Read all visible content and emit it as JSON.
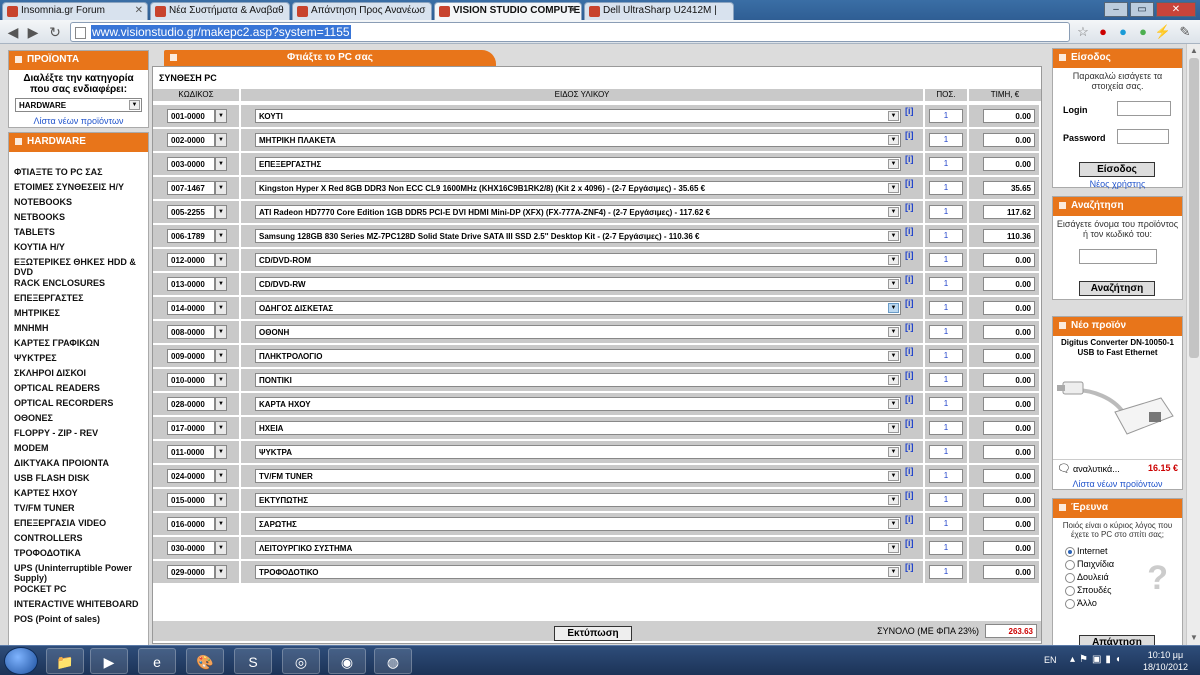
{
  "browser": {
    "tabs": [
      {
        "title": "Insomnia.gr Forum"
      },
      {
        "title": "Νέα Συστήματα & Αναβαθ"
      },
      {
        "title": "Απάντηση Προς Ανανέωσ"
      },
      {
        "title": "VISION STUDIO COMPUTE"
      },
      {
        "title": "Dell UltraSharp U2412M |"
      }
    ],
    "url": "www.visionstudio.gr/makepc2.asp?system=1155"
  },
  "left": {
    "products_title": "ΠΡΟΪΟΝΤΑ",
    "category_prompt": "Διαλέξτε την κατηγορία που σας ενδιαφέρει:",
    "category_value": "HARDWARE",
    "new_products_link": "Λίστα νέων προϊόντων",
    "hardware_title": "HARDWARE",
    "menu": [
      "ΦΤΙΑΞΤΕ ΤΟ PC ΣΑΣ",
      "ΕΤΟΙΜΕΣ ΣΥΝΘΕΣΕΙΣ Η/Υ",
      "NOTEBOOKS",
      "NETBOOKS",
      "TABLETS",
      "ΚΟΥΤΙΑ Η/Υ",
      "ΕΞΩΤΕΡΙΚΕΣ ΘΗΚΕΣ HDD & DVD",
      "RACK ENCLOSURES",
      "ΕΠΕΞΕΡΓΑΣΤΕΣ",
      "ΜΗΤΡΙΚΕΣ",
      "ΜΝΗΜΗ",
      "ΚΑΡΤΕΣ ΓΡΑΦΙΚΩΝ",
      "ΨΥΚΤΡΕΣ",
      "ΣΚΛΗΡΟΙ ΔΙΣΚΟΙ",
      "OPTICAL READERS",
      "OPTICAL RECORDERS",
      "ΟΘΟΝΕΣ",
      "FLOPPY - ZIP - REV",
      "MODEM",
      "ΔΙΚΤΥΑΚΑ ΠΡΟΙΟΝΤΑ",
      "USB FLASH DISK",
      "ΚΑΡΤΕΣ ΗΧΟΥ",
      "TV/FM TUNER",
      "ΕΠΕΞΕΡΓΑΣΙΑ VIDEO",
      "CONTROLLERS",
      "ΤΡΟΦΟΔΟΤΙΚΑ",
      "UPS (Uninterruptible Power Supply)",
      "POCKET PC",
      "INTERACTIVE WHITEBOARD",
      "POS (Point of sales)"
    ]
  },
  "main": {
    "tab_label": "Φτιάξτε το PC σας",
    "section_title": "ΣΥΝΘΕΣΗ PC",
    "headers": {
      "code": "ΚΩΔΙΚΟΣ",
      "desc": "ΕΙΔΟΣ ΥΛΙΚΟΥ",
      "qty": "ΠΟΣ.",
      "price": "ΤΙΜΗ, €"
    },
    "info_label": "[i]",
    "rows": [
      {
        "code": "001-0000",
        "desc": "ΚΟΥΤΙ",
        "qty": "1",
        "price": "0.00"
      },
      {
        "code": "002-0000",
        "desc": "ΜΗΤΡΙΚΗ ΠΛΑΚΕΤΑ",
        "qty": "1",
        "price": "0.00"
      },
      {
        "code": "003-0000",
        "desc": "ΕΠΕΞΕΡΓΑΣΤΗΣ",
        "qty": "1",
        "price": "0.00"
      },
      {
        "code": "007-1467",
        "desc": "Kingston Hyper X Red 8GB DDR3 Non ECC CL9 1600MHz (KHX16C9B1RK2/8) (Kit 2 x 4096) - (2-7 Εργάσιμες) - 35.65 €",
        "qty": "1",
        "price": "35.65"
      },
      {
        "code": "005-2255",
        "desc": "ATI Radeon HD7770 Core Edition 1GB DDR5 PCI-E DVI HDMI Mini-DP (XFX) (FX-777A-ZNF4) - (2-7 Εργάσιμες) - 117.62 €",
        "qty": "1",
        "price": "117.62"
      },
      {
        "code": "006-1789",
        "desc": "Samsung 128GB 830 Series MZ-7PC128D Solid State Drive SATA III SSD 2.5'' Desktop Kit - (2-7 Εργάσιμες) - 110.36 €",
        "qty": "1",
        "price": "110.36"
      },
      {
        "code": "012-0000",
        "desc": "CD/DVD-ROM",
        "qty": "1",
        "price": "0.00"
      },
      {
        "code": "013-0000",
        "desc": "CD/DVD-RW",
        "qty": "1",
        "price": "0.00"
      },
      {
        "code": "014-0000",
        "desc": "ΟΔΗΓΟΣ ΔΙΣΚΕΤΑΣ",
        "qty": "1",
        "price": "0.00"
      },
      {
        "code": "008-0000",
        "desc": "ΟΘΟΝΗ",
        "qty": "1",
        "price": "0.00"
      },
      {
        "code": "009-0000",
        "desc": "ΠΛΗΚΤΡΟΛΟΓΙΟ",
        "qty": "1",
        "price": "0.00"
      },
      {
        "code": "010-0000",
        "desc": "ΠΟΝΤΙΚΙ",
        "qty": "1",
        "price": "0.00"
      },
      {
        "code": "028-0000",
        "desc": "ΚΑΡΤΑ ΗΧΟΥ",
        "qty": "1",
        "price": "0.00"
      },
      {
        "code": "017-0000",
        "desc": "ΗΧΕΙΑ",
        "qty": "1",
        "price": "0.00"
      },
      {
        "code": "011-0000",
        "desc": "ΨΥΚΤΡΑ",
        "qty": "1",
        "price": "0.00"
      },
      {
        "code": "024-0000",
        "desc": "TV/FM TUNER",
        "qty": "1",
        "price": "0.00"
      },
      {
        "code": "015-0000",
        "desc": "ΕΚΤΥΠΩΤΗΣ",
        "qty": "1",
        "price": "0.00"
      },
      {
        "code": "016-0000",
        "desc": "ΣΑΡΩΤΗΣ",
        "qty": "1",
        "price": "0.00"
      },
      {
        "code": "030-0000",
        "desc": "ΛΕΙΤΟΥΡΓΙΚΟ ΣΥΣΤΗΜΑ",
        "qty": "1",
        "price": "0.00"
      },
      {
        "code": "029-0000",
        "desc": "ΤΡΟΦΟΔΟΤΙΚΟ",
        "qty": "1",
        "price": "0.00"
      }
    ],
    "total_label": "ΣΥΝΟΛΟ (ΜΕ ΦΠΑ 23%)",
    "total_value": "263.63",
    "print_label": "Εκτύπωση"
  },
  "right": {
    "login_title": "Είσοδος",
    "login_text": "Παρακαλώ εισάγετε τα στοιχεία σας.",
    "login_label": "Login",
    "password_label": "Password",
    "login_button": "Είσοδος",
    "new_user_link": "Νέος χρήστης",
    "search_title": "Αναζήτηση",
    "search_text": "Εισάγετε όνομα του προϊόντος ή τον κωδικό του:",
    "search_button": "Αναζήτηση",
    "newprod_title": "Νέο προϊόν",
    "newprod_name": "Digitus Converter DN-10050-1 USB to Fast Ethernet",
    "newprod_details": "αναλυτικά...",
    "newprod_price": "16.15 €",
    "newprod_link": "Λίστα νέων προϊόντων",
    "poll_title": "Έρευνα",
    "poll_question": "Ποιός είναι ο κύριος λόγος που έχετε το PC στο σπίτι σας;",
    "poll_options": [
      "Internet",
      "Παιχνίδια",
      "Δουλειά",
      "Σπουδές",
      "Άλλο"
    ],
    "poll_button": "Απάντηση"
  },
  "taskbar": {
    "lang": "EN",
    "time": "10:10 μμ",
    "date": "18/10/2012"
  },
  "colors": {
    "accent": "#e8751a",
    "total": "#cc0000",
    "link": "#2255cc"
  }
}
